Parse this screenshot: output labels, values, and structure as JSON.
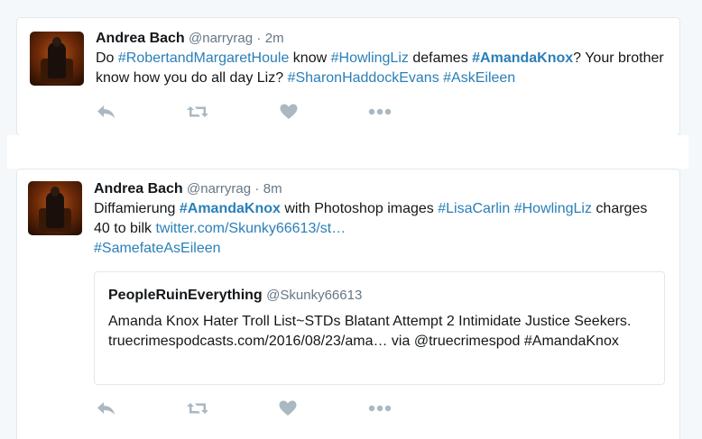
{
  "tweets": [
    {
      "author": "Andrea Bach",
      "handle": "@narryrag",
      "sep": "·",
      "time": "2m",
      "segments": [
        {
          "t": "Do ",
          "k": "text"
        },
        {
          "t": "#RobertandMargaretHoule",
          "k": "tag"
        },
        {
          "t": " know ",
          "k": "text"
        },
        {
          "t": "#HowlingLiz",
          "k": "tag"
        },
        {
          "t": " defames ",
          "k": "text"
        },
        {
          "t": "#AmandaKnox",
          "k": "tagstrong"
        },
        {
          "t": "? Your brother know how you do all day Liz?  ",
          "k": "text"
        },
        {
          "t": "#SharonHaddockEvans",
          "k": "tag"
        },
        {
          "t": " ",
          "k": "text"
        },
        {
          "t": "#AskEileen",
          "k": "tag"
        }
      ]
    },
    {
      "author": "Andrea Bach",
      "handle": "@narryrag",
      "sep": "·",
      "time": "8m",
      "segments": [
        {
          "t": "Diffamierung ",
          "k": "text"
        },
        {
          "t": "#AmandaKnox",
          "k": "tagstrong"
        },
        {
          "t": " with Photoshop images ",
          "k": "text"
        },
        {
          "t": "#LisaCarlin",
          "k": "tag"
        },
        {
          "t": " ",
          "k": "text"
        },
        {
          "t": "#HowlingLiz",
          "k": "tag"
        },
        {
          "t": " charges 40 to bilk  ",
          "k": "text"
        },
        {
          "t": "twitter.com/Skunky66613/st…",
          "k": "link"
        },
        {
          "t": " ",
          "k": "text"
        },
        {
          "t": "#SamefateAsEileen",
          "k": "tag"
        }
      ],
      "quote": {
        "name": "PeopleRuinEverything",
        "handle": "@Skunky66613",
        "text": "Amanda Knox Hater Troll List~STDs Blatant Attempt 2 Intimidate Justice Seekers. truecrimespodcasts.com/2016/08/23/ama… via @truecrimespod #AmandaKnox"
      }
    }
  ],
  "actions": [
    "reply-icon",
    "retweet-icon",
    "like-icon",
    "more-icon"
  ],
  "colors": {
    "link": "#2a7fb8",
    "muted": "#657786",
    "icon": "#aab8c2",
    "border": "#e1e8ed"
  }
}
